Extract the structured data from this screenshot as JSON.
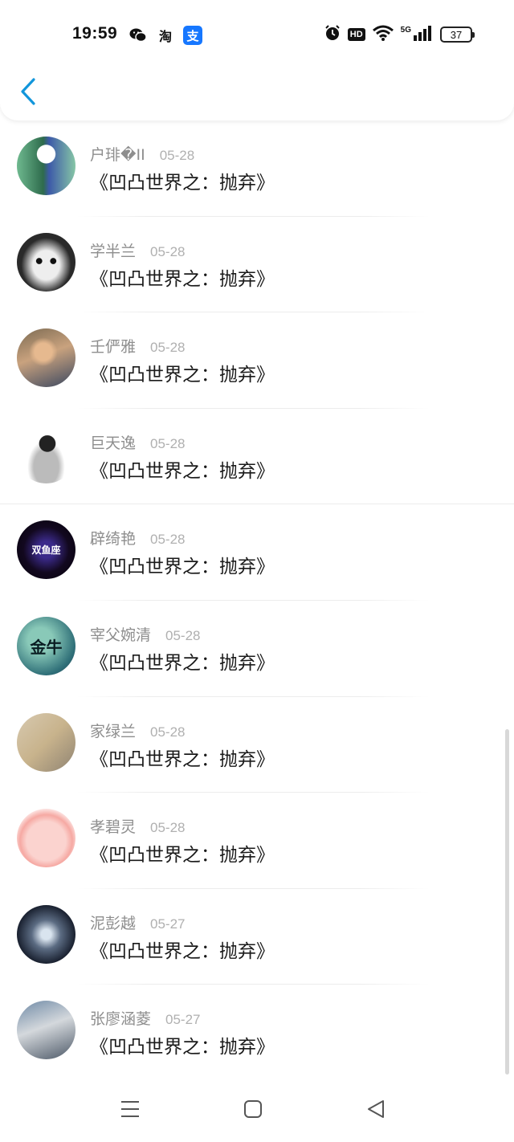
{
  "status_bar": {
    "time": "19:59",
    "app_icons": [
      "wechat-icon",
      "taobao-icon",
      "alipay-icon"
    ],
    "taobao_glyph": "淘",
    "alipay_glyph": "支",
    "hd_label": "HD",
    "network_label": "5G",
    "battery_level": "37"
  },
  "header": {
    "back_icon": "chevron-left-icon",
    "accent": "#1296db"
  },
  "comments": [
    {
      "name": "户琲�II",
      "date": "05-28",
      "message": "《凹凸世界之：抛弃》",
      "avatar": "av1"
    },
    {
      "name": "学半兰",
      "date": "05-28",
      "message": "《凹凸世界之：抛弃》",
      "avatar": "av2"
    },
    {
      "name": "壬俨雅",
      "date": "05-28",
      "message": "《凹凸世界之：抛弃》",
      "avatar": "av3"
    },
    {
      "name": "巨天逸",
      "date": "05-28",
      "message": "《凹凸世界之：抛弃》",
      "avatar": "av4"
    },
    {
      "name": "辟绮艳",
      "date": "05-28",
      "message": "《凹凸世界之：抛弃》",
      "avatar": "av5",
      "avatar_text": "双鱼座"
    },
    {
      "name": "宰父婉清",
      "date": "05-28",
      "message": "《凹凸世界之：抛弃》",
      "avatar": "av6",
      "avatar_text": "金牛"
    },
    {
      "name": "家绿兰",
      "date": "05-28",
      "message": "《凹凸世界之：抛弃》",
      "avatar": "av7"
    },
    {
      "name": "孝碧灵",
      "date": "05-28",
      "message": "《凹凸世界之：抛弃》",
      "avatar": "av8"
    },
    {
      "name": "泥彭越",
      "date": "05-27",
      "message": "《凹凸世界之：抛弃》",
      "avatar": "av9"
    },
    {
      "name": "张廖涵菱",
      "date": "05-27",
      "message": "《凹凸世界之：抛弃》",
      "avatar": "av10"
    }
  ],
  "nav_bar": {
    "icons": [
      "menu-icon",
      "home-square-icon",
      "back-triangle-icon"
    ]
  }
}
